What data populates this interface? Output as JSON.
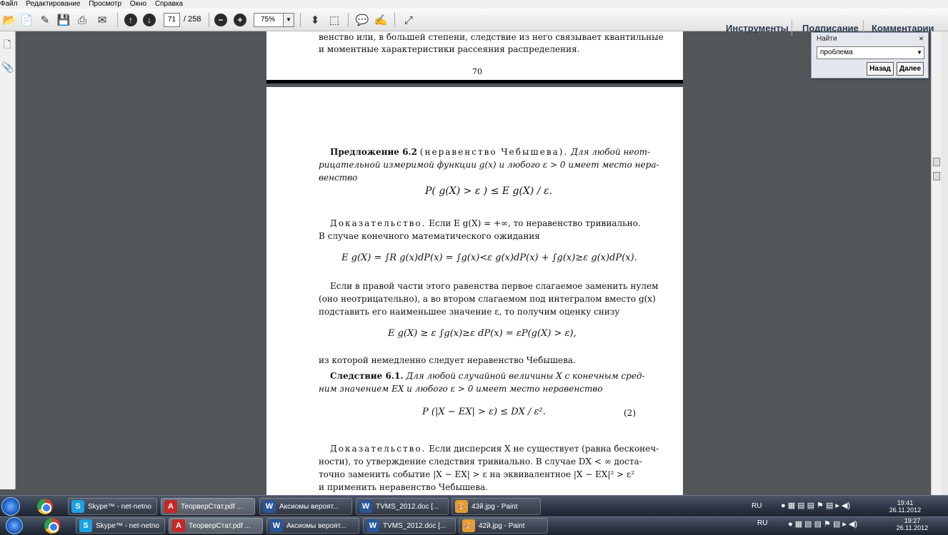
{
  "menu": {
    "items": [
      "Файл",
      "Редактирование",
      "Просмотр",
      "Окно",
      "Справка"
    ]
  },
  "toolbar": {
    "page_current": "71",
    "page_total": "/ 258",
    "zoom": "75%",
    "links": [
      "Инструменты",
      "Подписание",
      "Комментарии"
    ]
  },
  "find": {
    "title": "Найти",
    "close": "×",
    "query": "проблема",
    "back_label": "Назад",
    "next_label": "Далее"
  },
  "document": {
    "page_prev": {
      "line1": "венство или, в большей степени, следствие из него связывает квантильные",
      "line2": "и моментные характеристики рассеяния распределения.",
      "page_number": "70"
    },
    "prop_title": "Предложение 6.2",
    "prop_name": "(неравенство   Чебышева).",
    "prop_line1": "Для любой неот-",
    "prop_line2": "рицательной измеримой функции g(x) и любого ε > 0 имеет место нера-",
    "prop_line3": "венство",
    "formula1": "P( g(X) > ε ) ≤ E g(X) / ε.",
    "proof_label": "Доказательство.",
    "proof_line1": "Если E g(X) = +∞, то неравенство тривиально.",
    "proof_line2": "В случае конечного математического ожидания",
    "formula2": "E g(X) = ∫R g(x)dP(x) = ∫g(x)<ε g(x)dP(x) + ∫g(x)≥ε g(x)dP(x).",
    "para_line1": "Если в правой части этого равенства первое слагаемое заменить нулем",
    "para_line2": "(оно неотрицательно), а во втором слагаемом под интегралом вместо g(x)",
    "para_line3": "подставить его наименьшее значение ε, то получим оценку снизу",
    "formula3": "E g(X) ≥ ε ∫g(x)≥ε dP(x) = εP(g(X) > ε),",
    "para2_line1": "из которой немедленно следует неравенство Чебышева.",
    "cor_title": "Следствие 6.1.",
    "cor_line1": "Для любой случайной величины X с конечным сред-",
    "cor_line2": "ним значением EX и любого ε > 0 имеет место неравенство",
    "formula4": "P (|X − EX| > ε) ≤ DX / ε².",
    "formula4_num": "(2)",
    "proof2_label": "Доказательство.",
    "proof2_line1": "Если дисперсия X не существует (равна бесконеч-",
    "proof2_line2": "ности), то утверждение следствия тривиально. В случае DX < ∞ доста-",
    "proof2_line3": "точно заменить событие |X − EX| > ε на эквивалентное |X − EX|² > ε²",
    "proof2_line4": "и применить неравенство Чебышева."
  },
  "taskbar1": {
    "tasks": [
      "Skype™ - net-netno",
      "ТеорверСтат.pdf ...",
      "Аксиомы вероят...",
      "TVMS_2012.doc [...",
      "43й.jpg - Paint"
    ],
    "lang": "RU",
    "time": "19:41",
    "date": "26.11.2012"
  },
  "taskbar2": {
    "tasks": [
      "Skype™ - net-netno",
      "ТеорверСтат.pdf ...",
      "Аксиомы вероят...",
      "TVMS_2012.doc [...",
      "42й.jpg - Paint"
    ],
    "lang": "RU",
    "time": "19:27",
    "date": "26.11.2012"
  }
}
